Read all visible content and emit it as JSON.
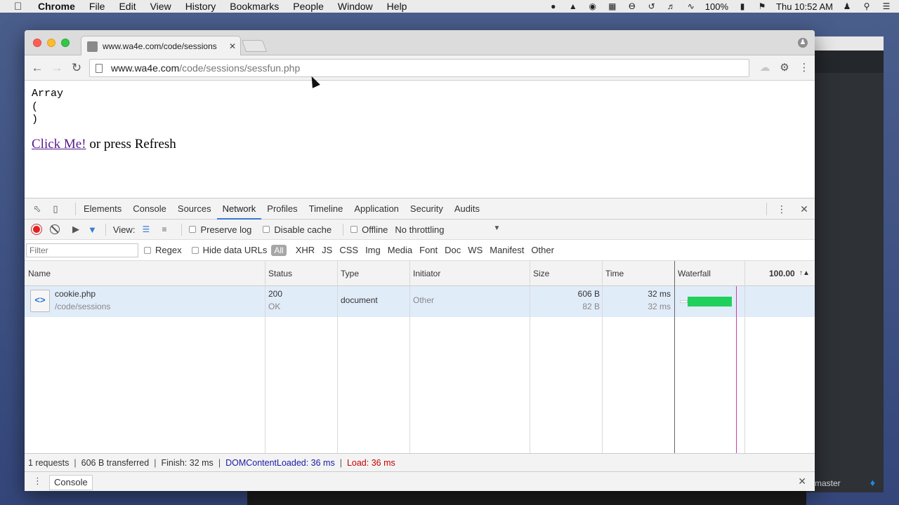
{
  "menubar": {
    "app_name": "Chrome",
    "items": [
      "File",
      "Edit",
      "View",
      "History",
      "Bookmarks",
      "People",
      "Window",
      "Help"
    ],
    "battery": "100%",
    "clock": "Thu 10:52 AM"
  },
  "background_window": {
    "branch": "master"
  },
  "browser": {
    "tab_title": "www.wa4e.com/code/sessions",
    "url_host": "www.wa4e.com",
    "url_path": "/code/sessions/sessfun.php"
  },
  "page": {
    "pre_lines": [
      "Array",
      "(",
      ")"
    ],
    "link_text": "Click Me!",
    "trailing_text": " or press Refresh"
  },
  "devtools": {
    "tabs": [
      "Elements",
      "Console",
      "Sources",
      "Network",
      "Profiles",
      "Timeline",
      "Application",
      "Security",
      "Audits"
    ],
    "active_tab": "Network",
    "toolbar": {
      "view_label": "View:",
      "preserve_log": "Preserve log",
      "disable_cache": "Disable cache",
      "offline": "Offline",
      "throttling": "No throttling"
    },
    "filter": {
      "placeholder": "Filter",
      "regex": "Regex",
      "hide_data_urls": "Hide data URLs",
      "types": [
        "All",
        "XHR",
        "JS",
        "CSS",
        "Img",
        "Media",
        "Font",
        "Doc",
        "WS",
        "Manifest",
        "Other"
      ]
    },
    "columns": {
      "name": "Name",
      "status": "Status",
      "type": "Type",
      "initiator": "Initiator",
      "size": "Size",
      "time": "Time",
      "waterfall": "Waterfall",
      "waterfall_scale": "100.00"
    },
    "rows": [
      {
        "name": "cookie.php",
        "path": "/code/sessions",
        "status": "200",
        "status_text": "OK",
        "type": "document",
        "initiator": "Other",
        "size": "606 B",
        "size_content": "82 B",
        "time": "32 ms",
        "latency": "32 ms"
      }
    ],
    "status_bar": {
      "requests": "1 requests",
      "transferred": "606 B transferred",
      "finish": "Finish: 32 ms",
      "dcl": "DOMContentLoaded: 36 ms",
      "load": "Load: 36 ms"
    },
    "drawer_tab": "Console"
  },
  "colors": {
    "waterfall_bar": "#1fd15c",
    "record": "#e51f1f",
    "link_visited": "#551a8b",
    "dcl": "#1a1aa6",
    "load": "#c80000"
  }
}
